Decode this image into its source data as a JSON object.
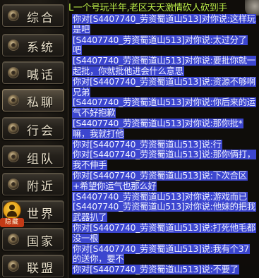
{
  "sidebar": {
    "tabs": [
      {
        "key": "all",
        "label": "综合"
      },
      {
        "key": "system",
        "label": "系统"
      },
      {
        "key": "shout",
        "label": "喊话"
      },
      {
        "key": "private",
        "label": "私聊"
      },
      {
        "key": "guild",
        "label": "行会"
      },
      {
        "key": "team",
        "label": "组队"
      },
      {
        "key": "nearby",
        "label": "附近"
      },
      {
        "key": "world",
        "label": "世界"
      },
      {
        "key": "nation",
        "label": "国家"
      },
      {
        "key": "alliance",
        "label": "联盟"
      }
    ],
    "active_tab": "private",
    "hide_badge_label": "隐藏"
  },
  "chat": {
    "broadcast": "L一个号玩半年,老区天天激情砍人砍到手",
    "messages": [
      {
        "prefix": "你对",
        "sender": "[S4407740_劳资蜀道山513]",
        "suffix": "对你说:这样玩是吧"
      },
      {
        "prefix": "",
        "sender": "[S4407740_劳资蜀道山513]",
        "suffix": "对你说:太过分了吧"
      },
      {
        "prefix": "",
        "sender": "[S4407740_劳资蜀道山513]",
        "suffix": "对你说:要批你就一起批，你就批他进会什么意思"
      },
      {
        "prefix": "你对",
        "sender": "[S4407740_劳资蜀道山513]",
        "suffix": "说:资源不够啊兄弟"
      },
      {
        "prefix": "",
        "sender": "[S4407740_劳资蜀道山513]",
        "suffix": "对你说:你后来的运气不好抱歉"
      },
      {
        "prefix": "",
        "sender": "[S4407740_劳资蜀道山513]",
        "suffix": "对你说:那你批*嘛，我就打他"
      },
      {
        "prefix": "你对",
        "sender": "[S4407740_劳资蜀道山513]",
        "suffix": "说:行"
      },
      {
        "prefix": "你对",
        "sender": "[S4407740_劳资蜀道山513]",
        "suffix": "说:那你俩打，我不伸手"
      },
      {
        "prefix": "你对",
        "sender": "[S4407740_劳资蜀道山513]",
        "suffix": "说:下次合区+希望你运气也那么好"
      },
      {
        "prefix": "",
        "sender": "[S4407740_劳资蜀道山513]",
        "suffix": "对你说:游戏而已"
      },
      {
        "prefix": "",
        "sender": "[S4407740_劳资蜀道山513]",
        "suffix": "对你说:他妹的把我武器扒了"
      },
      {
        "prefix": "你对",
        "sender": "[S4407740_劳资蜀道山513]",
        "suffix": "说:打死他毛都没一根"
      },
      {
        "prefix": "你对",
        "sender": "[S4407740_劳资蜀道山513]",
        "suffix": "说:我有个37的送你，要不"
      },
      {
        "prefix": "你对",
        "sender": "[S4407740_劳资蜀道山513]",
        "suffix": "说:不要了"
      }
    ]
  },
  "colors": {
    "message_highlight": "#3c46cf",
    "message_text": "#eef0ff",
    "broadcast_text": "#bff04a",
    "tab_text": "#e8dfc9",
    "badge_bg": "#c33a16"
  }
}
